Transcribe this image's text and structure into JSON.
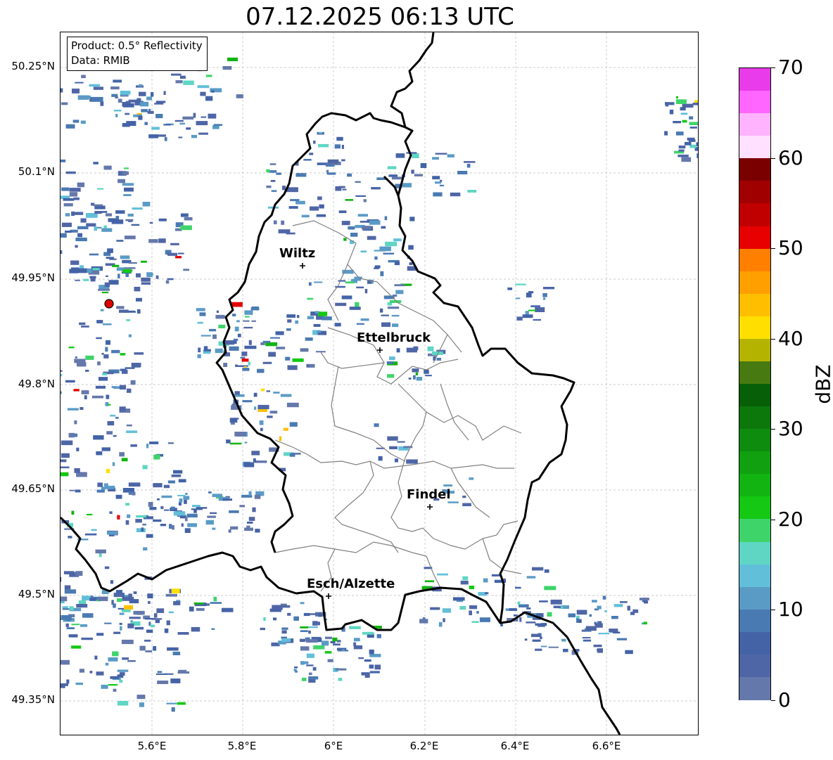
{
  "title": "07.12.2025 06:13 UTC",
  "info": {
    "product": "Product: 0.5° Reflectivity",
    "data": "Data: RMIB"
  },
  "lat_ticks": [
    "50.25°N",
    "50.1°N",
    "49.95°N",
    "49.8°N",
    "49.65°N",
    "49.5°N",
    "49.35°N"
  ],
  "lon_ticks": [
    "5.6°E",
    "5.8°E",
    "6°E",
    "6.2°E",
    "6.4°E",
    "6.6°E"
  ],
  "cities": [
    {
      "name": "Wiltz"
    },
    {
      "name": "Ettelbruck"
    },
    {
      "name": "Findel"
    },
    {
      "name": "Esch/Alzette"
    }
  ],
  "colorbar": {
    "label": "dBZ",
    "ticks": [
      "70",
      "60",
      "50",
      "40",
      "30",
      "20",
      "10",
      "0"
    ],
    "colors": [
      "#e93be9",
      "#ff66ff",
      "#ffb3ff",
      "#ffe0ff",
      "#7a0000",
      "#a00000",
      "#c00000",
      "#e60000",
      "#ff7f00",
      "#ff9f00",
      "#ffbf00",
      "#ffdf00",
      "#b4b400",
      "#477a10",
      "#075f07",
      "#0c780c",
      "#0e8c0e",
      "#10a010",
      "#12b412",
      "#14c814",
      "#3fd46a",
      "#5ed6c3",
      "#62bfd9",
      "#5a9bc6",
      "#4a7ab2",
      "#4463a7",
      "#4f66a6",
      "#6478ab"
    ]
  },
  "radar_site_color": "#e00000"
}
